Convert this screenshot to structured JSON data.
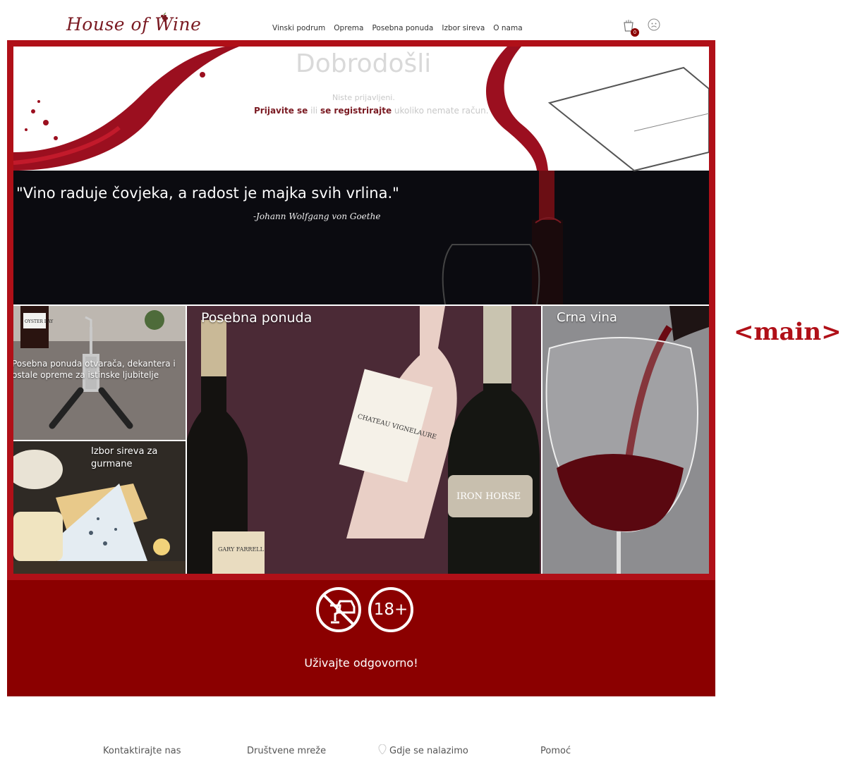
{
  "header": {
    "logo": "House of Wine",
    "nav": [
      "Vinski podrum",
      "Oprema",
      "Posebna ponuda",
      "Izbor sireva",
      "O nama"
    ],
    "cart_count": "0",
    "cart_icon": "cart-icon",
    "user_icon": "user-icon"
  },
  "hero": {
    "title": "Dobrodošli",
    "not_logged": "Niste prijavljeni.",
    "login_link": "Prijavite se",
    "or_text": " ili ",
    "register_link": "se registrirajte",
    "no_account_text": " ukoliko nemate račun.",
    "quote": "\"Vino raduje čovjeka, a radost je majka svih vrlina.\"",
    "quote_author": "-Johann Wolfgang von Goethe"
  },
  "tiles": {
    "openers": "Posebna ponuda otvarača, dekantera i ostale opreme za istinske ljubitelje",
    "cheese": "Izbor sireva za gurmane",
    "special": "Posebna ponuda",
    "red_wines": "Crna vina"
  },
  "bottle_labels": {
    "oyster": "OYSTER BAY",
    "gary": "GARY FARRELL",
    "chateau": "CHATEAU VIGNELAURE",
    "iron_horse": "IRON HORSE"
  },
  "responsible": {
    "age": "18+",
    "text": "Uživajte odgovorno!"
  },
  "footer": {
    "contact": "Kontaktirajte nas",
    "social": "Društvene mreže",
    "location": "Gdje se nalazimo",
    "help": "Pomoć"
  },
  "annotation": "<main>",
  "colors": {
    "accent": "#b01018",
    "banner": "#8b0000",
    "logo": "#7a1a22"
  }
}
